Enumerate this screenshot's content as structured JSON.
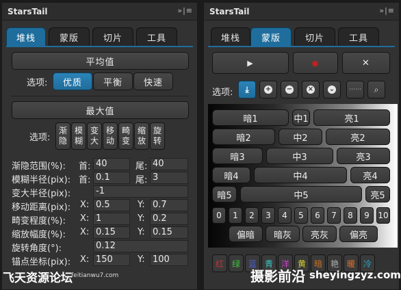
{
  "left": {
    "title": "StarsTail",
    "menu": "»|≡",
    "tabs": [
      "堆栈",
      "蒙版",
      "切片",
      "工具"
    ],
    "avg_button": "平均值",
    "opt_label1": "选项:",
    "quality_options": [
      "优质",
      "平衡",
      "快速"
    ],
    "max_button": "最大值",
    "opt_label2": "选项:",
    "max_options": [
      [
        "渐",
        "隐"
      ],
      [
        "模",
        "糊"
      ],
      [
        "变",
        "大"
      ],
      [
        "移",
        "动"
      ],
      [
        "畸",
        "变"
      ],
      [
        "缩",
        "放"
      ],
      [
        "旋",
        "转"
      ]
    ],
    "params": {
      "fade_label": "渐隐范围(%):",
      "fade_first": "首:",
      "fade_first_val": "40",
      "fade_last": "尾:",
      "fade_last_val": "40",
      "blur_label": "模糊半径(pix):",
      "blur_first": "首:",
      "blur_first_val": "0.1",
      "blur_last": "尾:",
      "blur_last_val": "3",
      "grow_label": "变大半径(pix):",
      "grow_val": "-1",
      "move_label": "移动距离(pix):",
      "move_x": "X:",
      "move_x_val": "0.5",
      "move_y": "Y:",
      "move_y_val": "0.7",
      "distort_label": "畸变程度(%):",
      "distort_x": "X:",
      "distort_x_val": "1",
      "distort_y": "Y:",
      "distort_y_val": "0.2",
      "scale_label": "缩放幅度(%):",
      "scale_x": "X:",
      "scale_x_val": "0.15",
      "scale_y": "Y:",
      "scale_y_val": "0.15",
      "rotate_label": "旋转角度(°):",
      "rotate_val": "0.12",
      "anchor_label": "锚点坐标(pix):",
      "anchor_x": "X:",
      "anchor_x_val": "150",
      "anchor_y": "Y:",
      "anchor_y_val": "100"
    }
  },
  "right": {
    "title": "StarsTail",
    "menu": "»|≡",
    "tabs": [
      "堆栈",
      "蒙版",
      "切片",
      "工具"
    ],
    "play": "▶",
    "record": "●",
    "close": "✕",
    "opt_label": "选项:",
    "tool_icons": [
      "download-icon",
      "plus-circle-icon",
      "minus-circle-icon",
      "x-circle-icon",
      "chevron-circle-icon",
      "dots-icon",
      "search-icon"
    ],
    "zones": {
      "dark1": "暗1",
      "mid1": "中1",
      "light1": "亮1",
      "dark2": "暗2",
      "mid2": "中2",
      "light2": "亮2",
      "dark3": "暗3",
      "mid3": "中3",
      "light3": "亮3",
      "dark4": "暗4",
      "mid4": "中4",
      "light4": "亮4",
      "dark5": "暗5",
      "mid5": "中5",
      "light5": "亮5"
    },
    "numbers": [
      "0",
      "1",
      "2",
      "3",
      "4",
      "5",
      "6",
      "7",
      "8",
      "9",
      "10"
    ],
    "tones": [
      "偏暗",
      "暗灰",
      "亮灰",
      "偏亮"
    ],
    "colors": [
      {
        "label": "红",
        "color": "#d03030"
      },
      {
        "label": "绿",
        "color": "#3cc23c"
      },
      {
        "label": "蓝",
        "color": "#4a5fe0"
      },
      {
        "label": "青",
        "color": "#3ac8c8"
      },
      {
        "label": "洋",
        "color": "#d040d0"
      },
      {
        "label": "黄",
        "color": "#d8d030"
      },
      {
        "label": "暗",
        "color": "#c87020"
      },
      {
        "label": "艳",
        "color": "#b0b0b0"
      },
      {
        "label": "暖",
        "color": "#e07028"
      },
      {
        "label": "冷",
        "color": "#28a8c8"
      }
    ]
  },
  "watermarks": {
    "left_brand": "飞天资源论坛",
    "left_url": "feitianwu7.com",
    "right_brand": "摄影前沿",
    "right_url": "sheyingzyz.com"
  }
}
